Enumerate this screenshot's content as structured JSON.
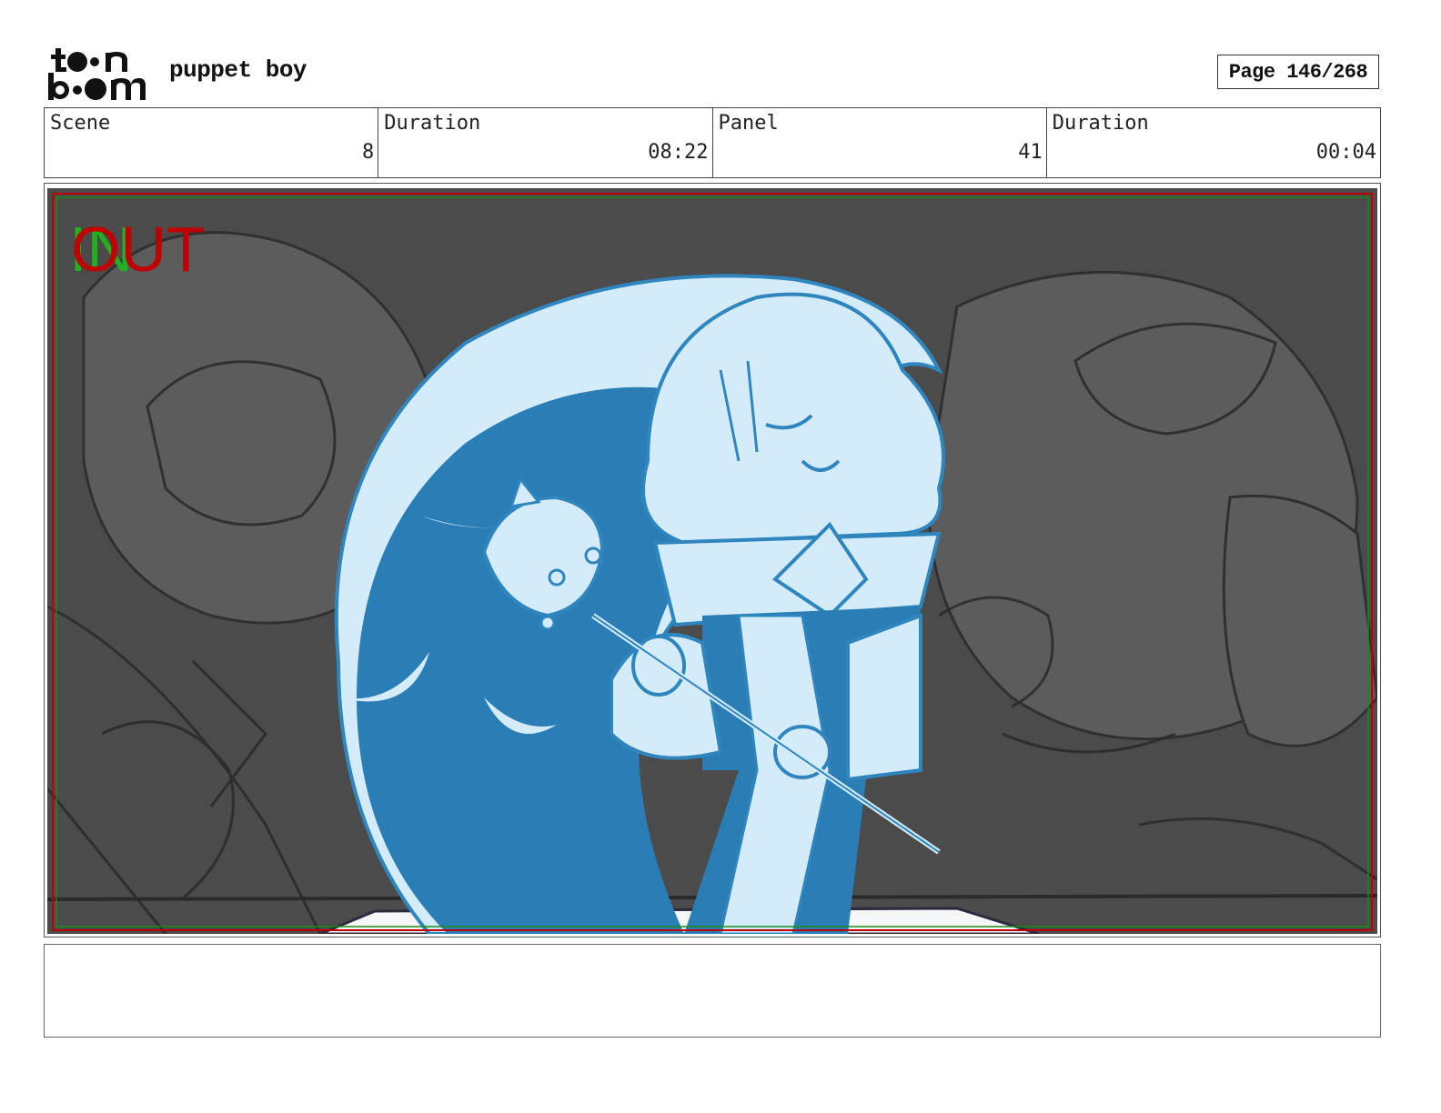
{
  "header": {
    "logo_text": "toon boom",
    "project_title": "puppet boy",
    "page_label": "Page 146/268"
  },
  "info": {
    "scene_label": "Scene",
    "scene_value": "8",
    "scene_duration_label": "Duration",
    "scene_duration_value": "08:22",
    "panel_label": "Panel",
    "panel_value": "41",
    "panel_duration_label": "Duration",
    "panel_duration_value": "00:04"
  },
  "panel": {
    "in_marker": "IN",
    "out_marker": "OUT",
    "colors": {
      "background_gray": "#4a4a4a",
      "character_light": "#d4ecfa",
      "character_dark": "#2a7db5",
      "outline": "#2f86bf",
      "in_marker": "#20b020",
      "out_marker": "#c00000"
    }
  },
  "notes": {
    "text": ""
  }
}
